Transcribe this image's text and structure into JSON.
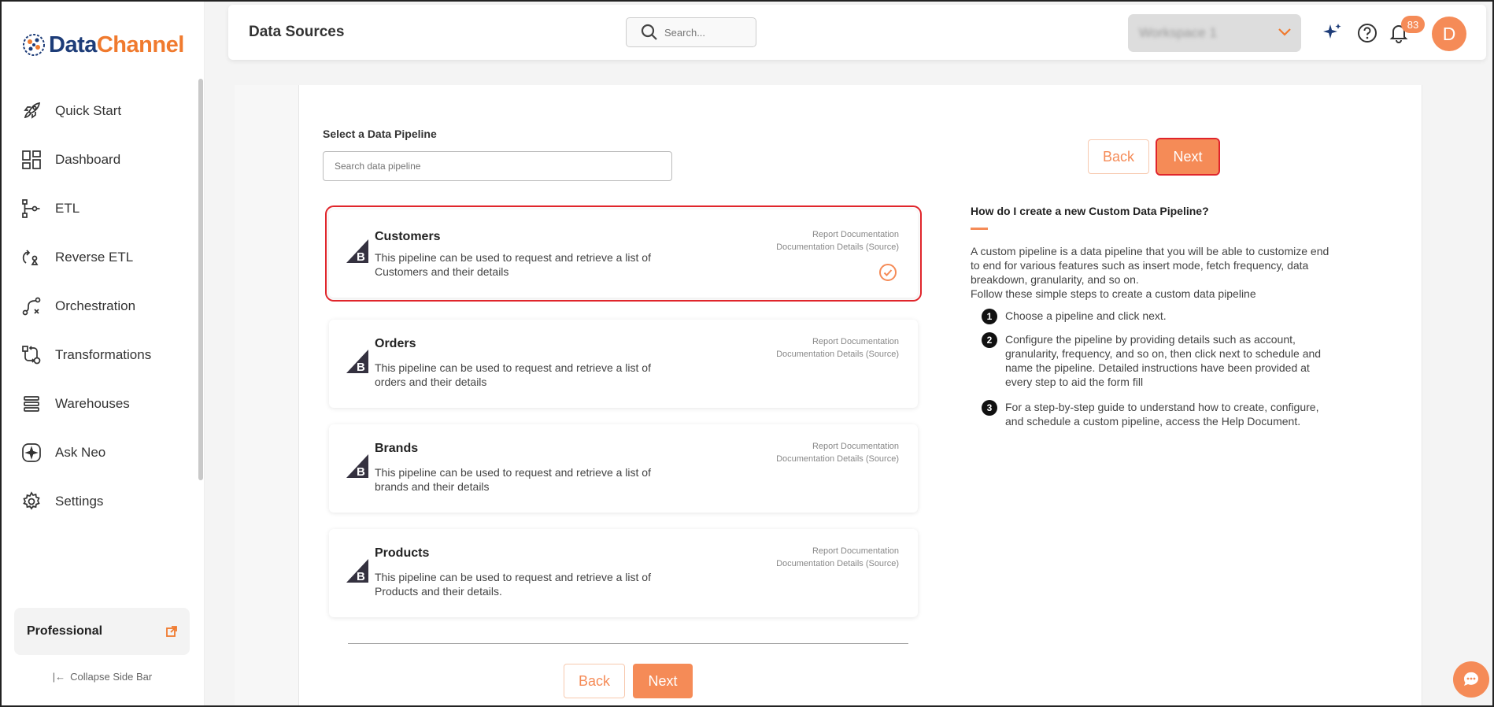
{
  "app": {
    "logo_part1": "Data",
    "logo_part2": "Channel"
  },
  "sidebar": {
    "items": [
      {
        "label": "Quick Start",
        "icon": "rocket-icon"
      },
      {
        "label": "Dashboard",
        "icon": "dashboard-icon"
      },
      {
        "label": "ETL",
        "icon": "etl-icon"
      },
      {
        "label": "Reverse ETL",
        "icon": "reverse-etl-icon"
      },
      {
        "label": "Orchestration",
        "icon": "orchestration-icon"
      },
      {
        "label": "Transformations",
        "icon": "transformations-icon"
      },
      {
        "label": "Warehouses",
        "icon": "warehouses-icon"
      },
      {
        "label": "Ask Neo",
        "icon": "ask-neo-icon"
      },
      {
        "label": "Settings",
        "icon": "gear-icon"
      }
    ],
    "plan_label": "Professional",
    "collapse_label": "Collapse Side Bar"
  },
  "header": {
    "title": "Data Sources",
    "search_placeholder": "Search...",
    "workspace": "Workspace 1",
    "notification_count": "83",
    "avatar_initial": "D"
  },
  "main": {
    "select_label": "Select a Data Pipeline",
    "search_placeholder": "Search data pipeline",
    "back_label": "Back",
    "next_label": "Next",
    "pipelines": [
      {
        "name": "Customers",
        "description": "This pipeline can be used to request and retrieve a list of Customers and their details",
        "doc1": "Report Documentation",
        "doc2": "Documentation Details (Source)",
        "selected": true
      },
      {
        "name": "Orders",
        "description": "This pipeline can be used to request and retrieve a list of orders and their details",
        "doc1": "Report Documentation",
        "doc2": "Documentation Details (Source)",
        "selected": false
      },
      {
        "name": "Brands",
        "description": "This pipeline can be used to request and retrieve a list of brands and their details",
        "doc1": "Report Documentation",
        "doc2": "Documentation Details (Source)",
        "selected": false
      },
      {
        "name": "Products",
        "description": "This pipeline can be used to request and retrieve a list of Products and their details.",
        "doc1": "Report Documentation",
        "doc2": "Documentation Details (Source)",
        "selected": false
      }
    ]
  },
  "help": {
    "title": "How do I create a new Custom Data Pipeline?",
    "intro": "A custom pipeline is a data pipeline that you will be able to customize end to end for various features such as insert mode, fetch frequency, data breakdown, granularity, and so on.",
    "intro2": "Follow these simple steps to create a custom data pipeline",
    "steps": [
      {
        "num": "1",
        "text": "Choose a pipeline and click next."
      },
      {
        "num": "2",
        "text": "Configure the pipeline by providing details such as account, granularity, frequency, and so on, then click next to schedule and name the pipeline. Detailed instructions have been provided at every step to aid the form fill"
      },
      {
        "num": "3",
        "text": "For a step-by-step guide to understand how to create, configure, and schedule a custom pipeline, access the Help Document."
      }
    ]
  },
  "colors": {
    "accent": "#f58b57",
    "brand_dark": "#1d3c78",
    "selection_outline": "#e0252b"
  }
}
